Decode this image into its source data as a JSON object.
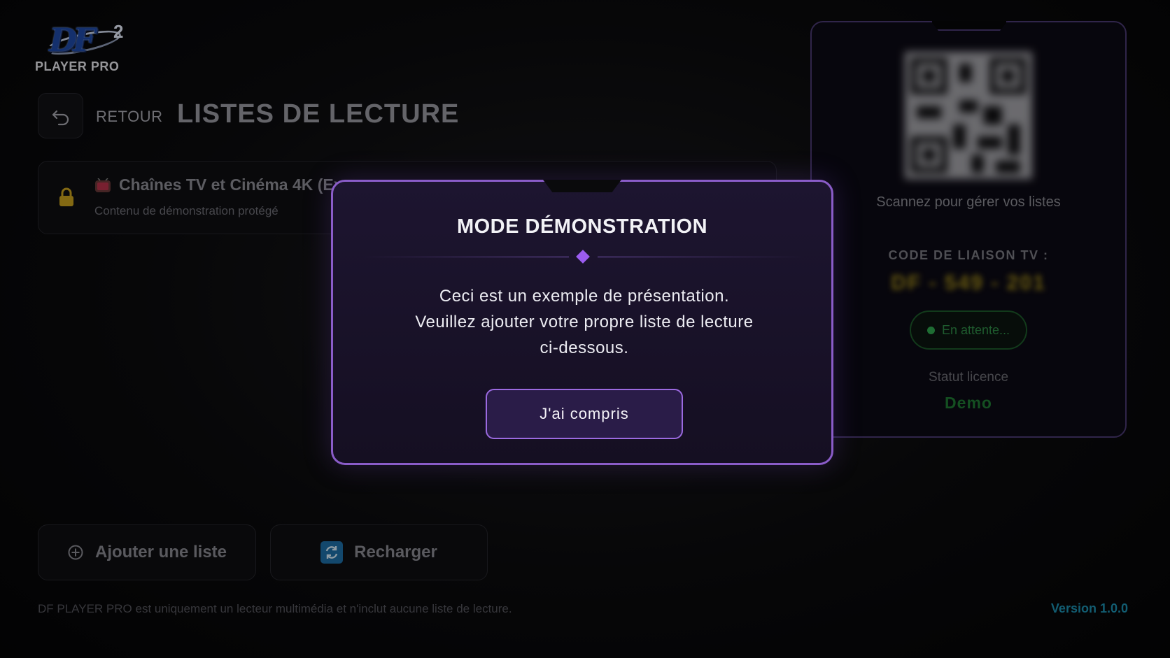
{
  "app": {
    "logo_mark": "DF",
    "logo_superscript": "2",
    "logo_text": "PLAYER PRO"
  },
  "header": {
    "back_label": "RETOUR",
    "title": "LISTES DE LECTURE"
  },
  "playlist": {
    "title": "Chaînes TV et Cinéma 4K (Ex",
    "subtitle": "Contenu de démonstration protégé"
  },
  "side_panel": {
    "scan_text": "Scannez pour gérer vos listes",
    "code_label": "CODE DE LIAISON TV :",
    "code_value": "DF - 549 - 201",
    "status_text": "En attente...",
    "license_label": "Statut licence",
    "license_value": "Demo"
  },
  "actions": {
    "add_label": "Ajouter une liste",
    "reload_label": "Recharger"
  },
  "footer": {
    "disclaimer": "DF PLAYER PRO est uniquement un lecteur multimédia et n'inclut aucune liste de lecture.",
    "version": "Version 1.0.0"
  },
  "modal": {
    "title": "MODE DÉMONSTRATION",
    "line1": "Ceci est un exemple de présentation.",
    "line2": "Veuillez ajouter votre propre liste de lecture",
    "line3": "ci-dessous.",
    "button_label": "J'ai compris"
  },
  "colors": {
    "accent": "#8a5cc8",
    "status_green": "#2fa84f",
    "version_blue": "#1c8fb0",
    "lock_gold": "#c9a21e"
  },
  "icons": {
    "back": "undo-arrow-icon",
    "lock": "lock-icon",
    "tv": "tv-icon",
    "add": "plus-circle-icon",
    "reload": "refresh-icon",
    "qr": "qr-code-icon"
  }
}
